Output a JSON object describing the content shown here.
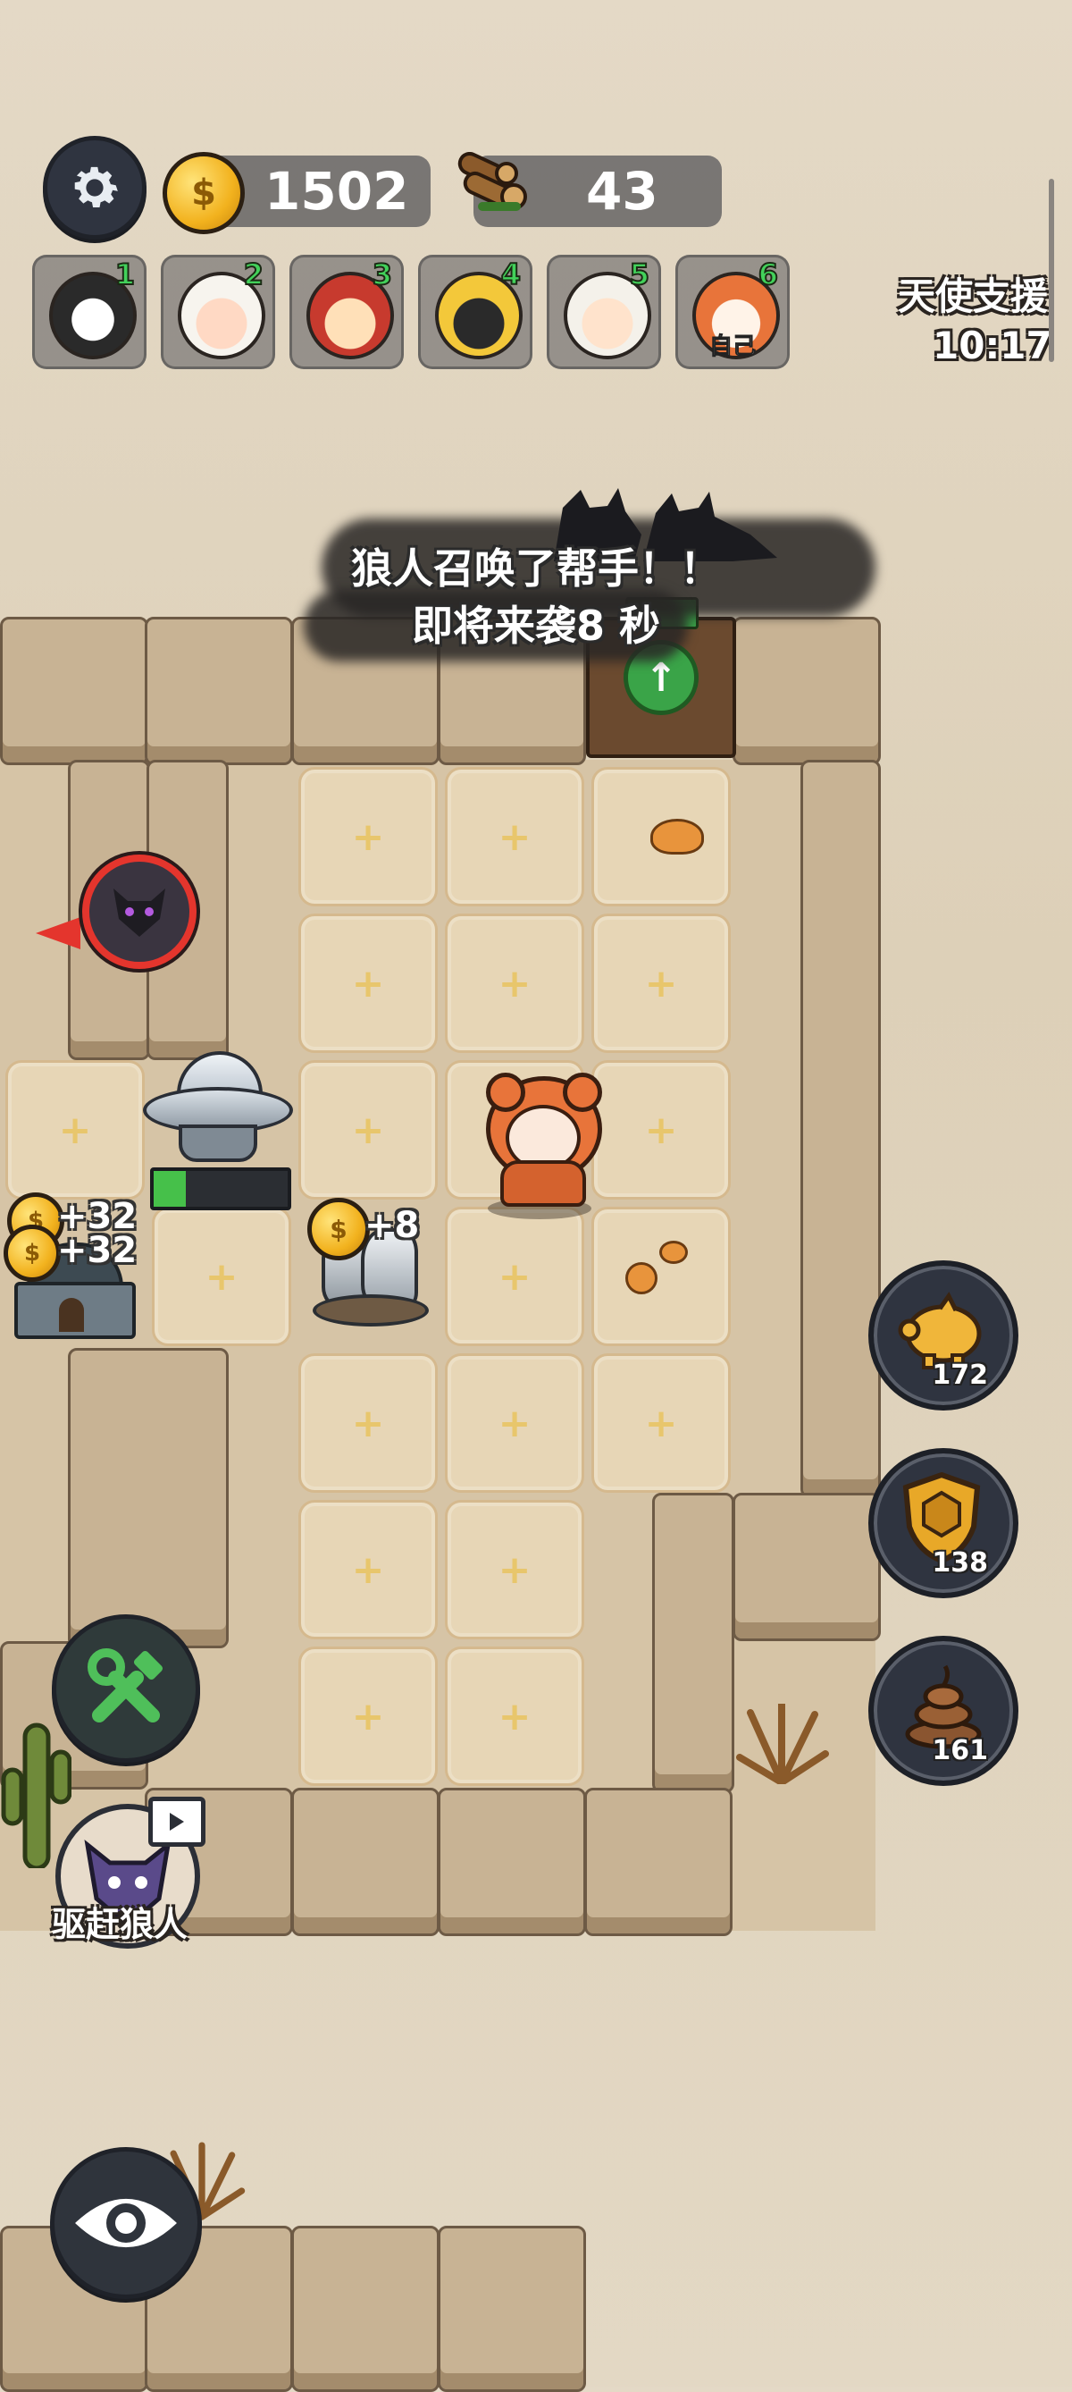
{
  "hud": {
    "gold": "1502",
    "wood": "43",
    "icons": {
      "settings": "gear-icon",
      "gold": "coin-icon",
      "wood": "logs-icon"
    }
  },
  "players": [
    {
      "number": "1",
      "tag": ""
    },
    {
      "number": "2",
      "tag": ""
    },
    {
      "number": "3",
      "tag": ""
    },
    {
      "number": "4",
      "tag": ""
    },
    {
      "number": "5",
      "tag": ""
    },
    {
      "number": "6",
      "tag": "自己"
    }
  ],
  "angel_support": {
    "label": "天使支援",
    "timer": "10:17"
  },
  "alert": {
    "line1": "狼人召唤了帮手！！",
    "line2": "即将来袭8 秒"
  },
  "board": {
    "tile_plus": "+",
    "gain_tower": "+32",
    "gain_tower2": "+32",
    "gain_ore": "+8"
  },
  "side_resources": [
    {
      "name": "piggy-bank",
      "count": "172"
    },
    {
      "name": "shield",
      "count": "138"
    },
    {
      "name": "poop",
      "count": "161"
    }
  ],
  "actions": {
    "build": "wrench-hammer-icon",
    "drive_wolf": "驱赶狼人",
    "view": "eye-icon"
  },
  "colors": {
    "accent_green": "#42d15a",
    "hud_dark": "#2f3440",
    "gold": "#f2b21e"
  }
}
